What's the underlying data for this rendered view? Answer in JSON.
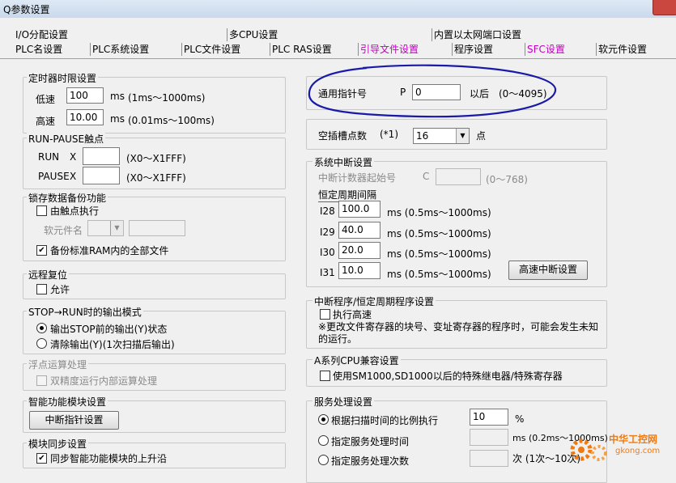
{
  "window": {
    "title": "Q参数设置"
  },
  "tabs": {
    "row1": [
      "I/O分配设置",
      "多CPU设置",
      "内置以太网端口设置"
    ],
    "row2": [
      "PLC名设置",
      "PLC系统设置",
      "PLC文件设置",
      "PLC RAS设置",
      "引导文件设置",
      "程序设置",
      "SFC设置",
      "软元件设置"
    ]
  },
  "timer": {
    "title": "定时器时限设置",
    "low_label": "低速",
    "low_value": "100",
    "low_unit": "ms",
    "low_range": "(1ms～1000ms)",
    "high_label": "高速",
    "high_value": "10.00",
    "high_unit": "ms",
    "high_range": "(0.01ms～100ms)"
  },
  "runpause": {
    "title": "RUN-PAUSE触点",
    "run_label": "RUN",
    "pause_label": "PAUSE",
    "x_prefix": "X",
    "run_value": "",
    "pause_value": "",
    "range": "(X0～X1FFF)"
  },
  "latch": {
    "title": "锁存数据备份功能",
    "contact_exec": "由触点执行",
    "device_name_label": "软元件名",
    "backup_all": "备份标准RAM内的全部文件"
  },
  "remote_reset": {
    "title": "远程复位",
    "allow": "允许"
  },
  "stop_run": {
    "title": "STOP→RUN时的输出模式",
    "opt1": "输出STOP前的输出(Y)状态",
    "opt2": "清除输出(Y)(1次扫描后输出)"
  },
  "float": {
    "title": "浮点运算处理",
    "double": "双精度运行内部运算处理"
  },
  "intelligent": {
    "title": "智能功能模块设置",
    "interrupt_pointer_btn": "中断指针设置"
  },
  "module_sync": {
    "title": "模块同步设置",
    "sync_rise": "同步智能功能模块的上升沿"
  },
  "pointer": {
    "label": "通用指针号",
    "p_label": "P",
    "value": "0",
    "suffix": "以后",
    "range": "(0～4095)"
  },
  "empty_slot": {
    "label": "空插槽点数",
    "note": "(*1)",
    "value": "16",
    "unit": "点"
  },
  "sys_interrupt": {
    "title": "系统中断设置",
    "counter_start_label": "中断计数器起始号",
    "c_label": "C",
    "counter_range": "(0～768)",
    "period_title": "恒定周期间隔",
    "rows": [
      {
        "name": "I28",
        "value": "100.0",
        "range": "ms  (0.5ms～1000ms)"
      },
      {
        "name": "I29",
        "value": "40.0",
        "range": "ms  (0.5ms～1000ms)"
      },
      {
        "name": "I30",
        "value": "20.0",
        "range": "ms  (0.5ms～1000ms)"
      },
      {
        "name": "I31",
        "value": "10.0",
        "range": "ms  (0.5ms～1000ms)"
      }
    ],
    "fast_btn": "高速中断设置"
  },
  "interrupt_prog": {
    "title": "中断程序/恒定周期程序设置",
    "fast_exec": "执行高速",
    "note": "※更改文件寄存器的块号、变址寄存器的程序时，可能会发生未知的运行。"
  },
  "a_series": {
    "title": "A系列CPU兼容设置",
    "use_sm": "使用SM1000,SD1000以后的特殊继电器/特殊寄存器"
  },
  "service": {
    "title": "服务处理设置",
    "opt1": "根据扫描时间的比例执行",
    "opt1_value": "10",
    "opt1_unit": "%",
    "opt2": "指定服务处理时间",
    "opt2_unit": "ms (0.2ms～1000ms)",
    "opt3": "指定服务处理次数",
    "opt3_unit": "次 (1次～10次)"
  },
  "watermark": {
    "line1": "中华工控网",
    "line2": "gkong.com"
  },
  "colors": {
    "tab_magenta": "#c000c0",
    "annotation_blue": "#1a1aa8",
    "watermark_orange": "#f07a10"
  }
}
